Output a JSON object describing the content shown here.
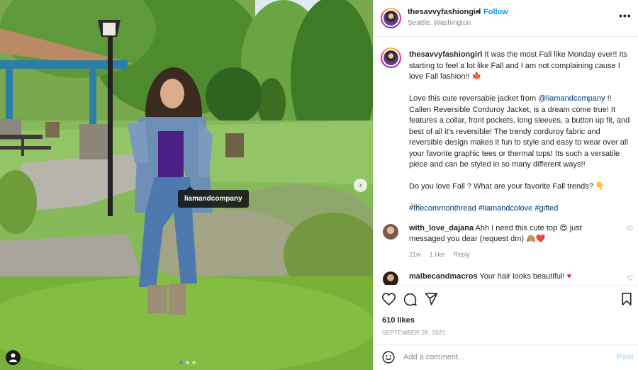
{
  "post": {
    "photo_tag": "liamandcompany"
  },
  "header": {
    "username": "thesavvyfashiongirl",
    "separator": "•",
    "follow_label": "Follow",
    "location": "Seattle, Washington",
    "more_label": "•••"
  },
  "caption": {
    "username": "thesavvyfashiongirl",
    "p1": " It was the most Fall like Monday ever!! Its starting to feel a lot like Fall and I am not complaining cause I love Fall fashion!! ",
    "p1_emoji": "🍁",
    "p2_before": "Love this cute reversable jacket from ",
    "p2_mention": "@liamandcompany",
    "p2_after": " !! Callen Reversible Corduroy Jacket, is a dream come true! It features a collar, front pockets, long sleeves, a button up fit, and best of all it's reversible! The trendy corduroy fabric and reversible design makes it fun to style and easy to wear over all your favorite graphic tees or thermal tops! Its such a versatile piece and can be styled in so many different ways!!",
    "p3": "Do you love Fall ? What are your favorite Fall trends? ",
    "p3_emoji": "👇",
    "hashtags": "#thecommonthread #liamandcolove #gifted",
    "time": "24w"
  },
  "comments": [
    {
      "username": "with_love_dajana",
      "text": " Ahh I need this cute top ",
      "emoji1": "😍",
      "text2": " just messaged you dear (request dm) ",
      "emoji2": "🙈",
      "emoji3": "❤️",
      "time": "21w",
      "likes": "1 like",
      "reply": "Reply",
      "heart": "♡"
    },
    {
      "username": "malbecandmacros",
      "text": " Your hair looks beautiful! ",
      "emoji1": "♥",
      "heart": "♡"
    }
  ],
  "actions": {
    "icons": [
      "heart-icon",
      "comment-icon",
      "share-icon",
      "save-icon"
    ],
    "likes": "610 likes",
    "date": "SEPTEMBER 28, 2021"
  },
  "add_comment": {
    "placeholder": "Add a comment...",
    "post_label": "Post"
  },
  "colors": {
    "link": "#00376b",
    "follow": "#0095f6",
    "post_disabled": "#b2dffc",
    "muted": "#8e8e8e"
  }
}
